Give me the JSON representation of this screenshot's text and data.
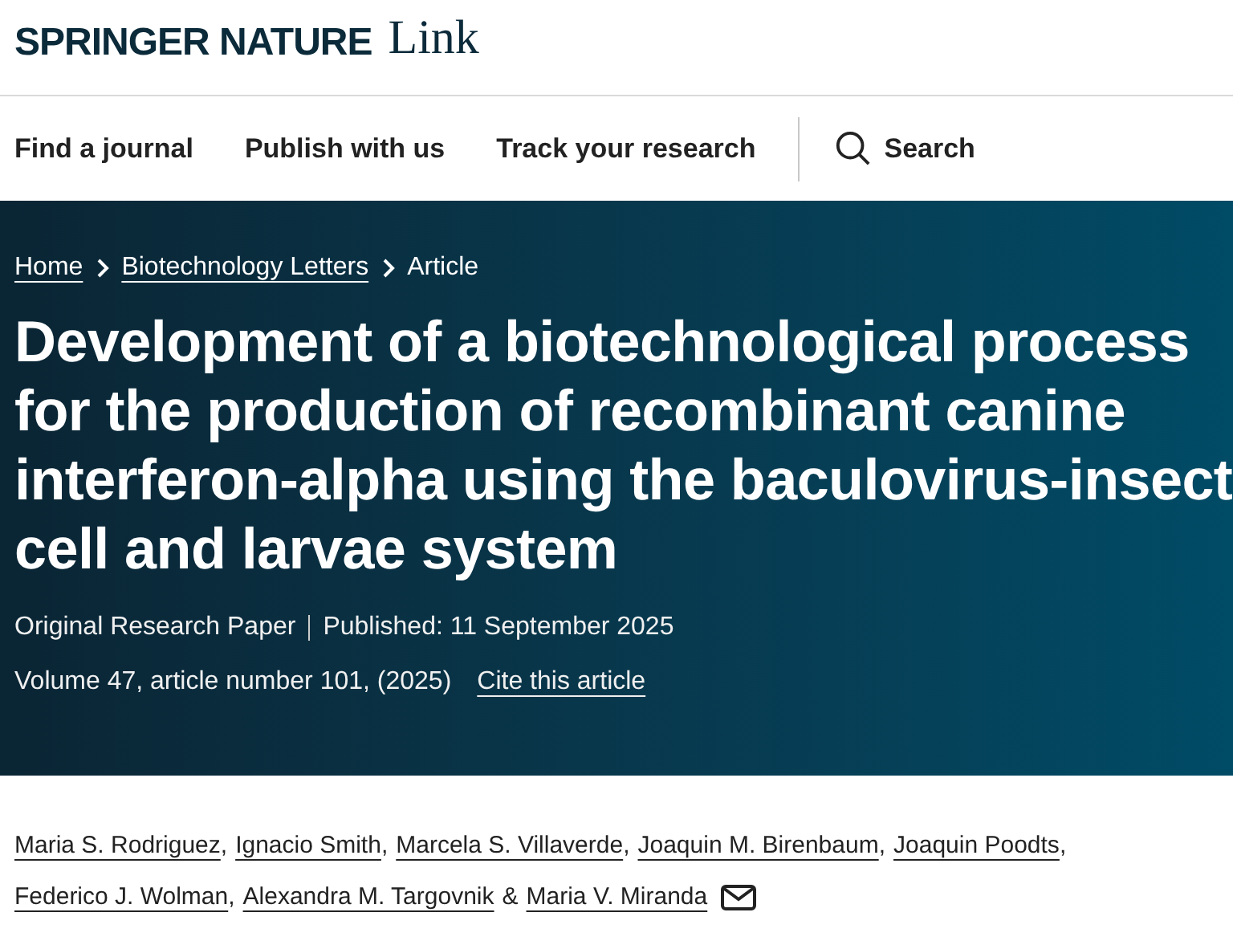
{
  "logo": {
    "brand": "SPRINGER NATURE",
    "product": "Link"
  },
  "nav": [
    {
      "label": "Find a journal"
    },
    {
      "label": "Publish with us"
    },
    {
      "label": "Track your research"
    }
  ],
  "search": {
    "label": "Search"
  },
  "breadcrumb": [
    {
      "label": "Home",
      "kind": "link"
    },
    {
      "label": "Biotechnology Letters",
      "kind": "link"
    },
    {
      "label": "Article",
      "kind": "current"
    }
  ],
  "title": "Development of a biotechnological process for the production of recombinant canine interferon-alpha using the baculovirus-insect cell and larvae system",
  "article_type": "Original Research Paper",
  "published": "Published: 11 September 2025",
  "citation": "Volume 47, article number 101, (2025)",
  "cite_link": "Cite this article",
  "authors": [
    {
      "name": "Maria S. Rodriguez",
      "separator": ",",
      "email": false
    },
    {
      "name": "Ignacio Smith",
      "separator": ",",
      "email": false
    },
    {
      "name": "Marcela S. Villaverde",
      "separator": ",",
      "email": false
    },
    {
      "name": "Joaquin M. Birenbaum",
      "separator": ",",
      "email": false
    },
    {
      "name": "Joaquin Poodts",
      "separator": ",",
      "email": false
    },
    {
      "name": "Federico J. Wolman",
      "separator": ",",
      "email": false
    },
    {
      "name": "Alexandra M. Targovnik",
      "separator": "&",
      "email": false
    },
    {
      "name": "Maria V. Miranda",
      "email": true
    }
  ]
}
